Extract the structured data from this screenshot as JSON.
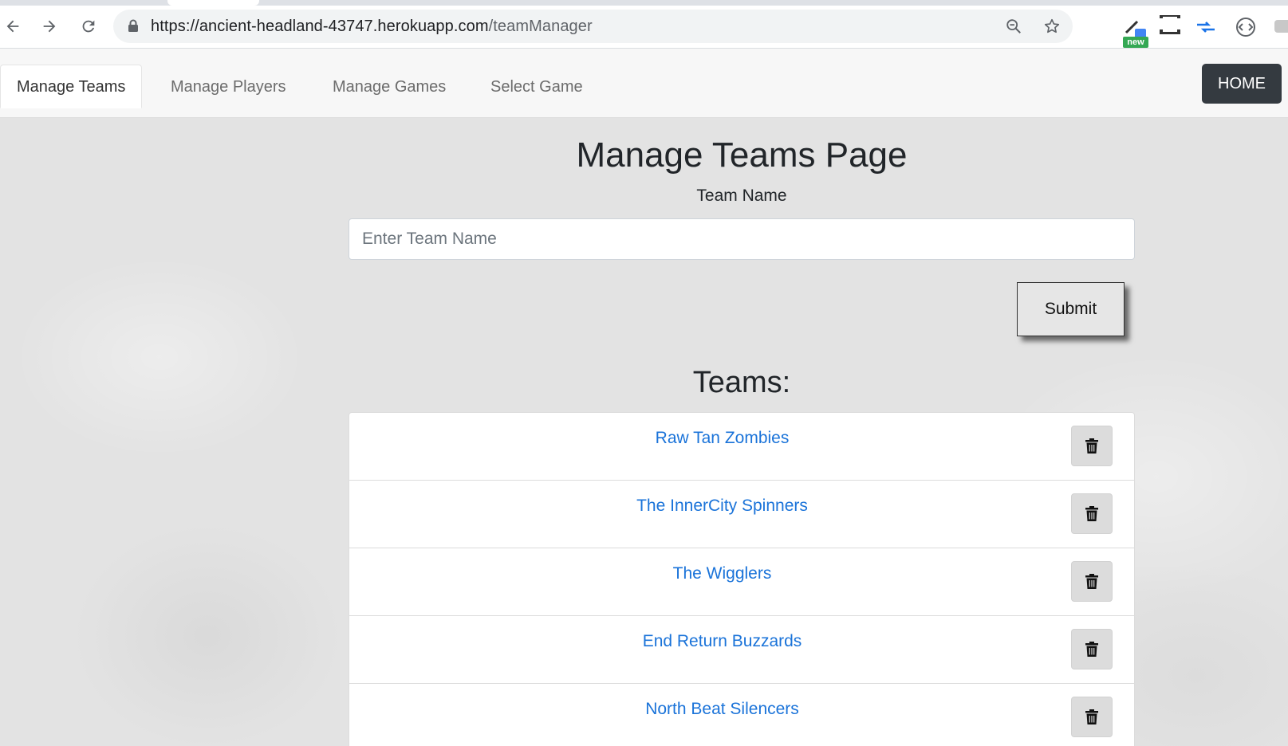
{
  "browser": {
    "url_host": "https://ancient-headland-43747.herokuapp.com",
    "url_path": "/teamManager",
    "extension_badge": "new",
    "icons": [
      "back-icon",
      "forward-icon",
      "reload-icon",
      "lock-icon",
      "zoom-icon",
      "star-icon",
      "eyedropper-extension-icon",
      "screenshot-extension-icon",
      "arrows-extension-icon",
      "code-extension-icon"
    ]
  },
  "navbar": {
    "tabs": [
      {
        "label": "Manage Teams",
        "active": true
      },
      {
        "label": "Manage Players",
        "active": false
      },
      {
        "label": "Manage Games",
        "active": false
      },
      {
        "label": "Select Game",
        "active": false
      }
    ],
    "home_label": "HOME"
  },
  "page": {
    "title": "Manage Teams Page",
    "field_label": "Team Name",
    "input_placeholder": "Enter Team Name",
    "input_value": "",
    "submit_label": "Submit",
    "teams_heading": "Teams:"
  },
  "teams": [
    {
      "name": "Raw Tan Zombies"
    },
    {
      "name": "The InnerCity Spinners"
    },
    {
      "name": "The Wigglers"
    },
    {
      "name": "End Return Buzzards"
    },
    {
      "name": "North Beat Silencers"
    }
  ],
  "colors": {
    "link": "#1a73d9",
    "home_button": "#343a40",
    "background": "#e3e3e3"
  }
}
